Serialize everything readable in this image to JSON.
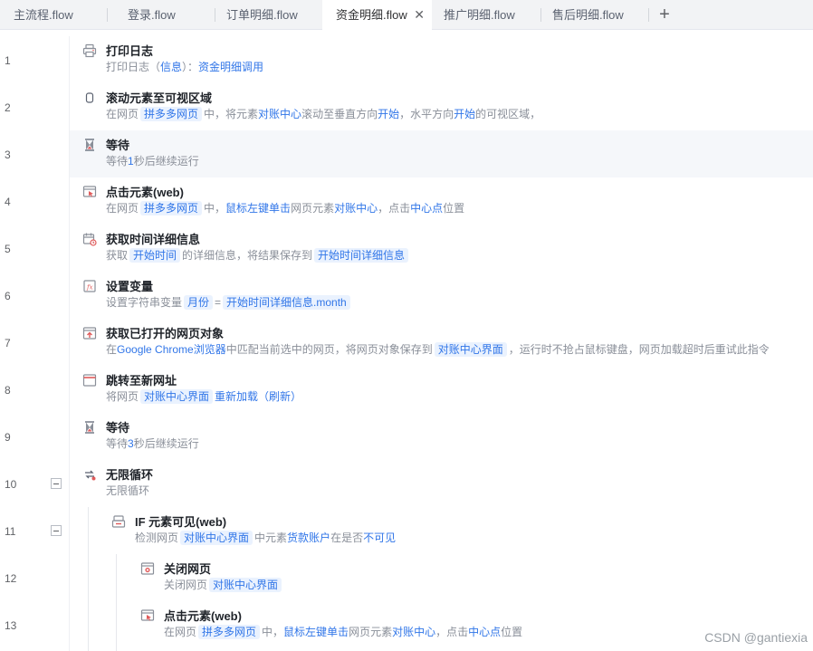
{
  "tabs": [
    {
      "label": "主流程.flow"
    },
    {
      "label": "登录.flow"
    },
    {
      "label": "订单明细.flow"
    },
    {
      "label": "资金明细.flow",
      "active": true
    },
    {
      "label": "推广明细.flow"
    },
    {
      "label": "售后明细.flow"
    }
  ],
  "tab_close_glyph": "✕",
  "tab_add_glyph": "+",
  "line_numbers": [
    "1",
    "2",
    "3",
    "4",
    "5",
    "6",
    "7",
    "8",
    "9",
    "10",
    "11",
    "12",
    "13"
  ],
  "steps": [
    {
      "title": "打印日志",
      "icon": "printer-icon",
      "desc": [
        {
          "t": "打印日志（",
          "k": "plain"
        },
        {
          "t": "信息",
          "k": "hl"
        },
        {
          "t": "）：",
          "k": "plain"
        },
        {
          "t": "资金明细调用",
          "k": "hl"
        }
      ]
    },
    {
      "title": "滚动元素至可视区域",
      "icon": "scroll-icon",
      "desc": [
        {
          "t": "在网页",
          "k": "plain"
        },
        {
          "t": "拼多多网页",
          "k": "tag"
        },
        {
          "t": "中，将元素",
          "k": "plain"
        },
        {
          "t": "对账中心",
          "k": "hl"
        },
        {
          "t": "滚动至垂直方向",
          "k": "plain"
        },
        {
          "t": "开始",
          "k": "hl"
        },
        {
          "t": "，水平方向",
          "k": "plain"
        },
        {
          "t": "开始",
          "k": "hl"
        },
        {
          "t": "的可视区域，",
          "k": "plain"
        }
      ]
    },
    {
      "title": "等待",
      "icon": "hourglass-icon",
      "desc": [
        {
          "t": "等待",
          "k": "plain"
        },
        {
          "t": "1",
          "k": "hl"
        },
        {
          "t": "秒后继续运行",
          "k": "plain"
        }
      ]
    },
    {
      "title": "点击元素(web)",
      "icon": "click-element-icon",
      "desc": [
        {
          "t": "在网页",
          "k": "plain"
        },
        {
          "t": "拼多多网页",
          "k": "tag"
        },
        {
          "t": "中，",
          "k": "plain"
        },
        {
          "t": "鼠标左键单击",
          "k": "hl"
        },
        {
          "t": "网页元素",
          "k": "plain"
        },
        {
          "t": "对账中心",
          "k": "hl"
        },
        {
          "t": "，点击",
          "k": "plain"
        },
        {
          "t": "中心点",
          "k": "hl"
        },
        {
          "t": "位置",
          "k": "plain"
        }
      ]
    },
    {
      "title": "获取时间详细信息",
      "icon": "calendar-icon",
      "desc": [
        {
          "t": "获取",
          "k": "plain"
        },
        {
          "t": "开始时间",
          "k": "tag"
        },
        {
          "t": "的详细信息，将结果保存到",
          "k": "plain"
        },
        {
          "t": "开始时间详细信息",
          "k": "tag"
        }
      ]
    },
    {
      "title": "设置变量",
      "icon": "variable-icon",
      "desc": [
        {
          "t": "设置字符串变量",
          "k": "plain"
        },
        {
          "t": "月份",
          "k": "tag"
        },
        {
          "t": "=",
          "k": "plain"
        },
        {
          "t": "开始时间详细信息.month",
          "k": "tag"
        }
      ]
    },
    {
      "title": "获取已打开的网页对象",
      "icon": "get-webpage-icon",
      "desc": [
        {
          "t": "在",
          "k": "plain"
        },
        {
          "t": "Google Chrome浏览器",
          "k": "hl"
        },
        {
          "t": "中匹配当前选中的网页，将网页对象保存到",
          "k": "plain"
        },
        {
          "t": "对账中心界面",
          "k": "tag"
        },
        {
          "t": "，运行时不抢占鼠标键盘，网页加载超时后重试此指令",
          "k": "plain"
        }
      ]
    },
    {
      "title": "跳转至新网址",
      "icon": "navigate-icon",
      "desc": [
        {
          "t": "将网页",
          "k": "plain"
        },
        {
          "t": "对账中心界面",
          "k": "tag"
        },
        {
          "t": "重新加载（刷新）",
          "k": "hl"
        }
      ]
    },
    {
      "title": "等待",
      "icon": "hourglass-icon",
      "desc": [
        {
          "t": "等待",
          "k": "plain"
        },
        {
          "t": "3",
          "k": "hl"
        },
        {
          "t": "秒后继续运行",
          "k": "plain"
        }
      ]
    },
    {
      "title": "无限循环",
      "icon": "loop-icon",
      "desc": [
        {
          "t": "无限循环",
          "k": "plain"
        }
      ]
    },
    {
      "title": "IF 元素可见(web)",
      "icon": "if-element-icon",
      "desc": [
        {
          "t": "检测网页",
          "k": "plain"
        },
        {
          "t": "对账中心界面",
          "k": "tag"
        },
        {
          "t": "中元素",
          "k": "plain"
        },
        {
          "t": "货款账户",
          "k": "hl"
        },
        {
          "t": "在是否",
          "k": "plain"
        },
        {
          "t": "不可见",
          "k": "hl"
        }
      ]
    },
    {
      "title": "关闭网页",
      "icon": "close-webpage-icon",
      "desc": [
        {
          "t": "关闭网页",
          "k": "plain"
        },
        {
          "t": "对账中心界面",
          "k": "tag"
        }
      ]
    },
    {
      "title": "点击元素(web)",
      "icon": "click-element-icon",
      "desc": [
        {
          "t": "在网页",
          "k": "plain"
        },
        {
          "t": "拼多多网页",
          "k": "tag"
        },
        {
          "t": "中，",
          "k": "plain"
        },
        {
          "t": "鼠标左键单击",
          "k": "hl"
        },
        {
          "t": "网页元素",
          "k": "plain"
        },
        {
          "t": "对账中心",
          "k": "hl"
        },
        {
          "t": "，点击",
          "k": "plain"
        },
        {
          "t": "中心点",
          "k": "hl"
        },
        {
          "t": "位置",
          "k": "plain"
        }
      ]
    }
  ],
  "watermark": "CSDN @gantiexia"
}
